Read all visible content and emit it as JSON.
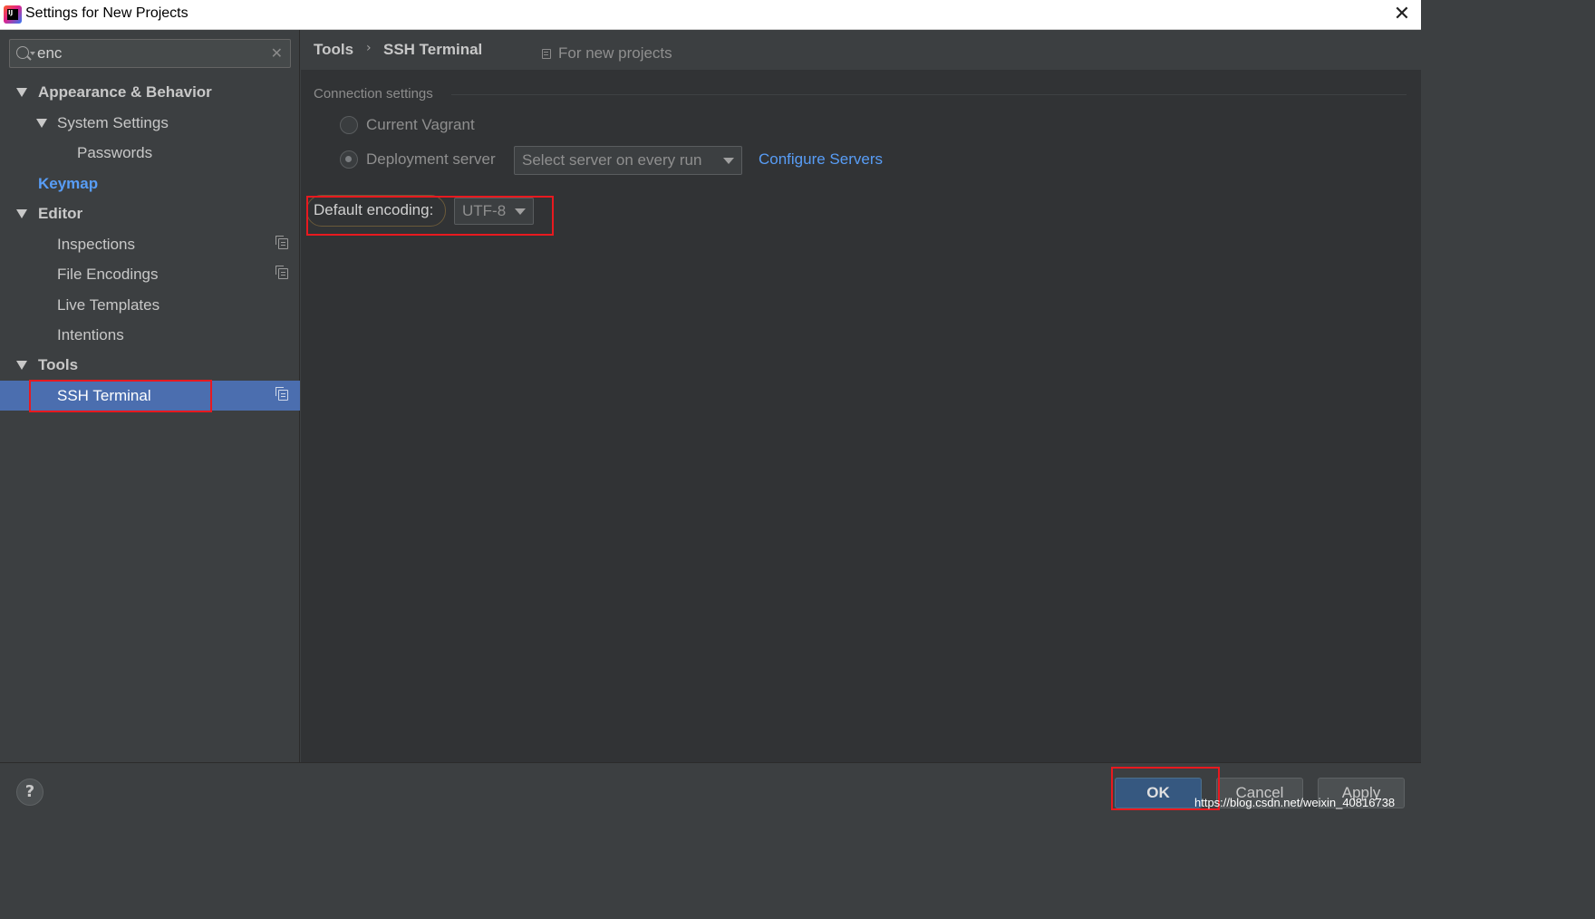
{
  "window": {
    "title": "Settings for New Projects",
    "app_icon_text": "IJ"
  },
  "sidebar": {
    "search": {
      "value": "enc",
      "placeholder": ""
    },
    "items": [
      {
        "label": "Appearance & Behavior"
      },
      {
        "label": "System Settings"
      },
      {
        "label": "Passwords"
      },
      {
        "label": "Keymap"
      },
      {
        "label": "Editor"
      },
      {
        "label": "Inspections"
      },
      {
        "label": "File Encodings"
      },
      {
        "label": "Live Templates"
      },
      {
        "label": "Intentions"
      },
      {
        "label": "Tools"
      },
      {
        "label": "SSH Terminal"
      }
    ]
  },
  "content": {
    "breadcrumb": [
      "Tools",
      "SSH Terminal"
    ],
    "breadcrumb_separator": "›",
    "scope_label": "For new projects",
    "connection_section": {
      "title": "Connection settings",
      "options": [
        {
          "label": "Current Vagrant",
          "checked": false
        },
        {
          "label": "Deployment server",
          "checked": true
        }
      ],
      "server_select": "Select server on every run",
      "configure_link": "Configure Servers"
    },
    "encoding": {
      "label": "Default encoding:",
      "value": "UTF-8"
    }
  },
  "footer": {
    "help_label": "?",
    "ok_label": "OK",
    "cancel_label": "Cancel",
    "apply_label": "Apply",
    "watermark": "https://blog.csdn.net/weixin_40816738"
  },
  "colors": {
    "accent_link": "#589df6",
    "selection": "#4b6eaf",
    "highlight_box": "#e8191f",
    "ok_button": "#365880"
  }
}
